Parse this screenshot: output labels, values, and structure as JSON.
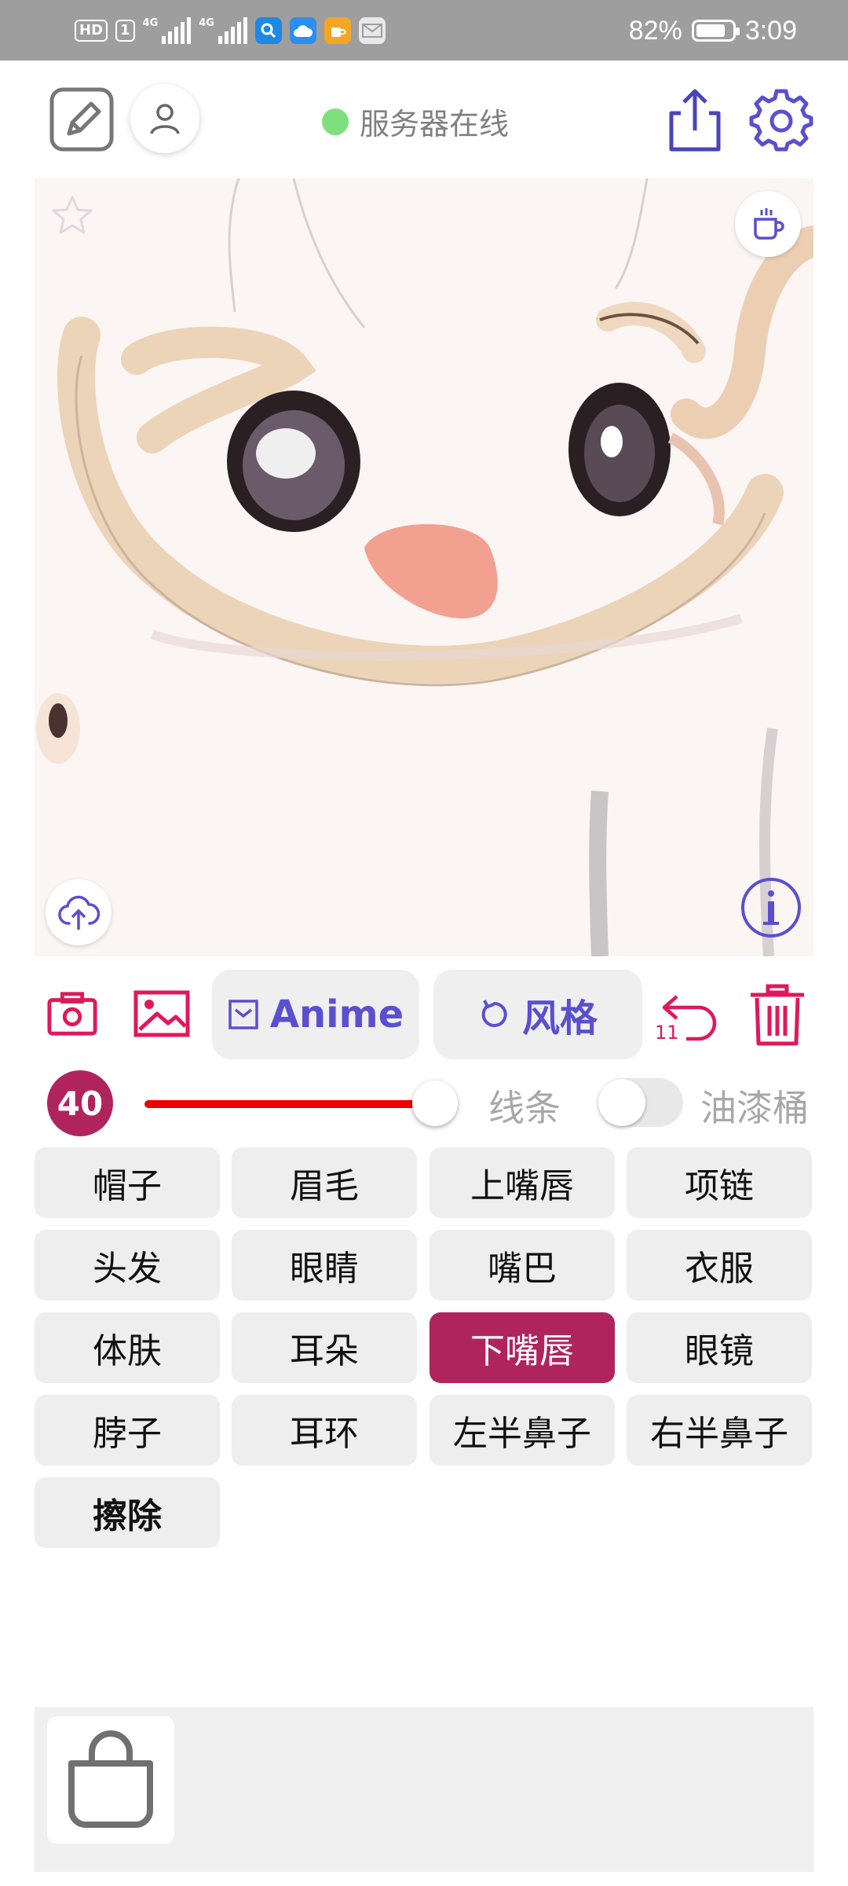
{
  "status_bar": {
    "hd_badge": "HD",
    "sim_badge": "1",
    "signal1_label": "4G",
    "signal2_label": "4G",
    "battery_percent": "82%",
    "battery_level": 0.82,
    "time": "3:09"
  },
  "header": {
    "server_status": "服务器在线",
    "server_status_color": "#7de07d"
  },
  "toolbar": {
    "mode_label": "Anime",
    "style_label": "风格",
    "undo_count": "11"
  },
  "brush": {
    "size": "40",
    "slider_fraction": 0.95,
    "line_label": "线条",
    "bucket_label": "油漆桶",
    "bucket_enabled": false
  },
  "tags": [
    {
      "label": "帽子"
    },
    {
      "label": "眉毛"
    },
    {
      "label": "上嘴唇"
    },
    {
      "label": "项链"
    },
    {
      "label": "头发"
    },
    {
      "label": "眼睛"
    },
    {
      "label": "嘴巴"
    },
    {
      "label": "衣服"
    },
    {
      "label": "体肤"
    },
    {
      "label": "耳朵"
    },
    {
      "label": "下嘴唇",
      "selected": true
    },
    {
      "label": "眼镜"
    },
    {
      "label": "脖子"
    },
    {
      "label": "耳环"
    },
    {
      "label": "左半鼻子"
    },
    {
      "label": "右半鼻子"
    },
    {
      "label": "擦除"
    }
  ],
  "colors": {
    "accent": "#5a4fd0",
    "danger": "#e0185a",
    "selected": "#b0245e",
    "slider": "#ee0000"
  }
}
